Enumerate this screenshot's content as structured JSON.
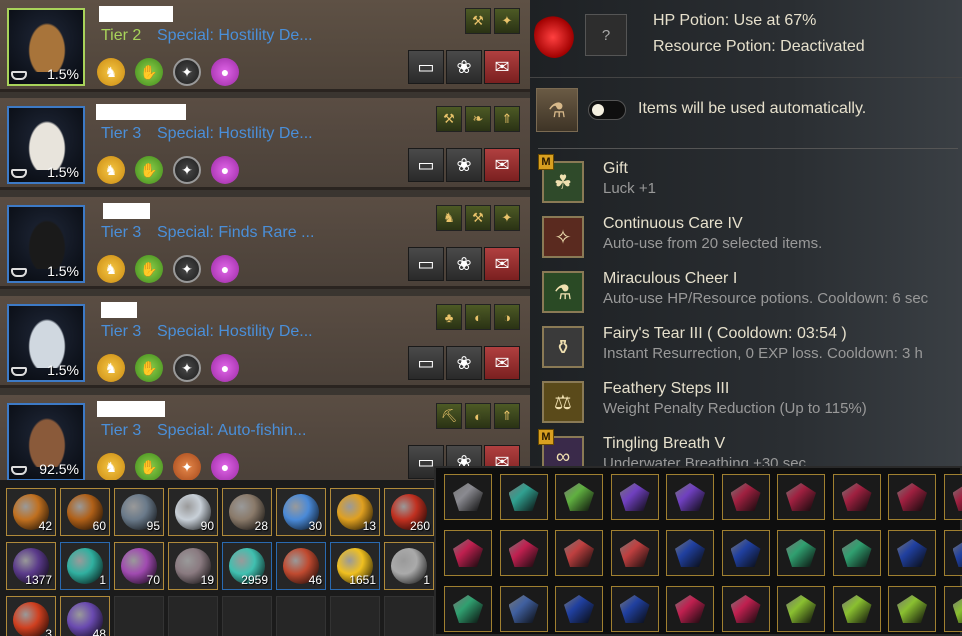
{
  "pets": [
    {
      "tier": "Tier 2",
      "special": "Special: Hostility De...",
      "level": "1.5%",
      "selected": true,
      "skills": [
        "⚒",
        "✦"
      ],
      "traits": [
        "yellow",
        "green",
        "white",
        "pink"
      ]
    },
    {
      "tier": "Tier 3",
      "special": "Special: Hostility De...",
      "level": "1.5%",
      "selected": false,
      "skills": [
        "⚒",
        "❧",
        "⇑"
      ],
      "traits": [
        "yellow",
        "green",
        "white",
        "pink"
      ]
    },
    {
      "tier": "Tier 3",
      "special": "Special: Finds Rare ...",
      "level": "1.5%",
      "selected": false,
      "skills": [
        "♞",
        "⚒",
        "✦"
      ],
      "traits": [
        "yellow",
        "green",
        "white",
        "pink"
      ]
    },
    {
      "tier": "Tier 3",
      "special": "Special: Hostility De...",
      "level": "1.5%",
      "selected": false,
      "skills": [
        "♣",
        "◐",
        "◑"
      ],
      "traits": [
        "yellow",
        "green",
        "white",
        "pink"
      ]
    },
    {
      "tier": "Tier 3",
      "special": "Special: Auto-fishin...",
      "level": "92.5%",
      "selected": false,
      "skills": [
        "⛏",
        "◐",
        "⇑"
      ],
      "traits": [
        "yellow",
        "green",
        "orange",
        "pink"
      ]
    }
  ],
  "potion": {
    "hp_text": "HP Potion: Use at 67%",
    "resource_text": "Resource Potion: Deactivated",
    "slot_label": "?"
  },
  "auto_use": {
    "label": "Items will be used automatically.",
    "enabled": false
  },
  "skills": [
    {
      "name": "Gift",
      "desc": "Luck +1",
      "icon": "gift-clover-icon",
      "glyph": "☘",
      "badge": "M",
      "color": "#2f4a2a"
    },
    {
      "name": "Continuous Care IV",
      "desc": "Auto-use from 20 selected items.",
      "icon": "fairy-care-icon",
      "glyph": "✧",
      "badge": "",
      "color": "#5a2a1f"
    },
    {
      "name": "Miraculous Cheer I",
      "desc": "Auto-use HP/Resource potions. Cooldown: 6 sec",
      "icon": "potion-cheer-icon",
      "glyph": "⚗",
      "badge": "",
      "color": "#2a4a25"
    },
    {
      "name": "Fairy's Tear III  ( Cooldown: 03:54 )",
      "desc": "Instant Resurrection, 0 EXP loss. Cooldown: 3 h",
      "icon": "fairy-tear-icon",
      "glyph": "⚱",
      "badge": "",
      "color": "#3a3a3a"
    },
    {
      "name": "Feathery Steps III",
      "desc": "Weight Penalty Reduction (Up to 115%)",
      "icon": "weight-icon",
      "glyph": "⚖",
      "badge": "",
      "color": "#5a4a1a"
    },
    {
      "name": "Tingling Breath V",
      "desc": "Underwater Breathing +30 sec",
      "icon": "breath-icon",
      "glyph": "∞",
      "badge": "M",
      "color": "#3a2a4a"
    }
  ],
  "inventory_left": [
    {
      "count": "42",
      "color": "#c07020",
      "border": "gold"
    },
    {
      "count": "60",
      "color": "#b06018",
      "border": "gold"
    },
    {
      "count": "95",
      "color": "#6a7a8a",
      "border": "gold"
    },
    {
      "count": "90",
      "color": "#c8d0d8",
      "border": "gold"
    },
    {
      "count": "28",
      "color": "#8a7a6a",
      "border": "gold"
    },
    {
      "count": "30",
      "color": "#4a8ad8",
      "border": "gold"
    },
    {
      "count": "13",
      "color": "#e0a020",
      "border": "gold"
    },
    {
      "count": "260",
      "color": "#c03020",
      "border": "gold"
    },
    {
      "count": "1377",
      "color": "#5a3a8a",
      "border": "gold"
    },
    {
      "count": "1",
      "color": "#30b0a0",
      "border": "blue"
    },
    {
      "count": "70",
      "color": "#a04ab0",
      "border": "gold"
    },
    {
      "count": "19",
      "color": "#8a7a80",
      "border": "gold"
    },
    {
      "count": "2959",
      "color": "#40c0b0",
      "border": "blue"
    },
    {
      "count": "46",
      "color": "#c04a30",
      "border": "blue"
    },
    {
      "count": "1651",
      "color": "#f0c020",
      "border": "blue"
    },
    {
      "count": "1",
      "color": "#aaaaaa",
      "border": "gold"
    },
    {
      "count": "3",
      "color": "#d04020",
      "border": "gold"
    },
    {
      "count": "48",
      "color": "#6a4ab0",
      "border": "gold"
    },
    {
      "count": "",
      "color": "",
      "border": "empty"
    },
    {
      "count": "",
      "color": "",
      "border": "empty"
    },
    {
      "count": "",
      "color": "",
      "border": "empty"
    },
    {
      "count": "",
      "color": "",
      "border": "empty"
    },
    {
      "count": "",
      "color": "",
      "border": "empty"
    },
    {
      "count": "",
      "color": "",
      "border": "empty"
    }
  ],
  "gems": [
    [
      "#8a8a90",
      "#30a090",
      "#60b040",
      "#7040c0",
      "#7040c0",
      "#a02040",
      "#a02040",
      "#a02040",
      "#a02040",
      "#a02040"
    ],
    [
      "#c02050",
      "#c02050",
      "#c04040",
      "#c04040",
      "#2040a0",
      "#2040a0",
      "#30a070",
      "#30a070",
      "#2040a0",
      "#2040a0"
    ],
    [
      "#30a070",
      "#4060a0",
      "#2040a0",
      "#2040a0",
      "#c02050",
      "#c02050",
      "#8ac030",
      "#8ac030",
      "#8ac030",
      "#8ac030"
    ]
  ]
}
